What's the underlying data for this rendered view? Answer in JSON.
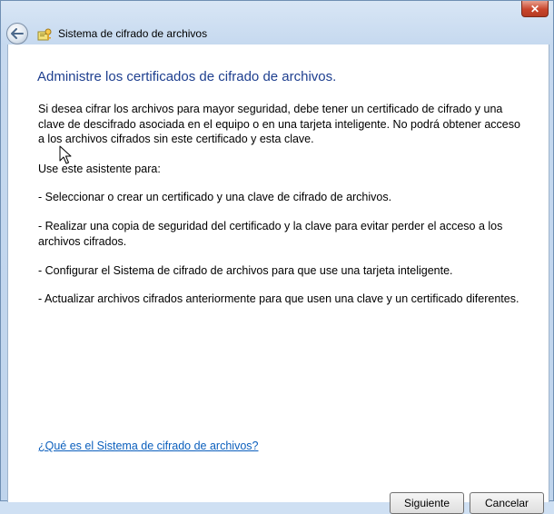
{
  "window": {
    "title": "Sistema de cifrado de archivos",
    "close_label": "✕"
  },
  "main": {
    "heading": "Administre los certificados de cifrado de archivos.",
    "intro": "Si desea cifrar los archivos para mayor seguridad, debe tener un certificado de cifrado y una clave de descifrado asociada en el equipo o en una tarjeta inteligente. No podrá obtener acceso a los archivos cifrados sin este certificado y esta clave.",
    "use_label": "Use este asistente para:",
    "bullets": [
      "- Seleccionar o crear un certificado y una clave de cifrado de archivos.",
      "- Realizar una copia de seguridad del certificado y la clave para evitar perder el acceso a los archivos cifrados.",
      "- Configurar el Sistema de cifrado de archivos para que use una tarjeta inteligente.",
      "- Actualizar archivos cifrados anteriormente para que usen una clave y un certificado diferentes."
    ],
    "help_link": "¿Qué es el Sistema de cifrado de archivos?"
  },
  "footer": {
    "next_label": "Siguiente",
    "cancel_label": "Cancelar"
  }
}
